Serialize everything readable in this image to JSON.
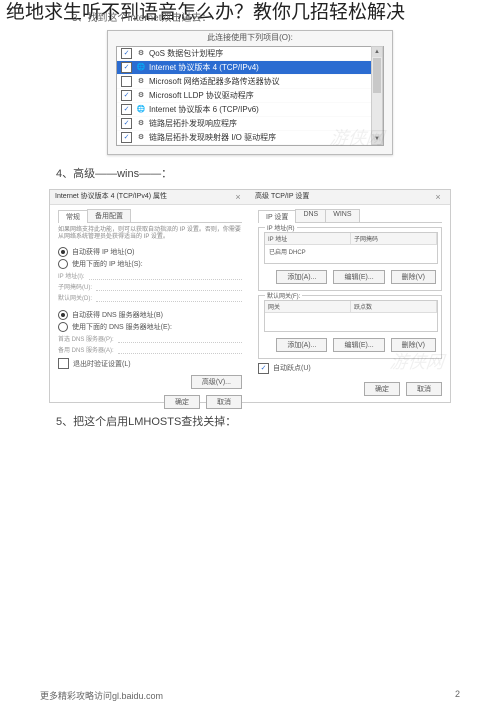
{
  "doc": {
    "title": "绝地求生听不到语音怎么办？教你几招轻松解决",
    "step3": "3、找到这个Internet双击进去：",
    "step4": "4、高级——wins——：",
    "step5": "5、把这个启用LMHOSTS查找关掉：",
    "footer_left": "更多精彩攻略访问gl.baidu.com",
    "footer_right": "2"
  },
  "shot1": {
    "caption": "此连接使用下列项目(O):",
    "watermark": "游侠网",
    "items": [
      {
        "checked": true,
        "icon": "⚙",
        "label": "QoS 数据包计划程序"
      },
      {
        "checked": true,
        "icon": "🌐",
        "label": "Internet 协议版本 4 (TCP/IPv4)",
        "selected": true
      },
      {
        "checked": false,
        "icon": "⚙",
        "label": "Microsoft 网络适配器多路传送器协议"
      },
      {
        "checked": true,
        "icon": "⚙",
        "label": "Microsoft LLDP 协议驱动程序"
      },
      {
        "checked": true,
        "icon": "🌐",
        "label": "Internet 协议版本 6 (TCP/IPv6)"
      },
      {
        "checked": true,
        "icon": "⚙",
        "label": "链路层拓扑发现响应程序"
      },
      {
        "checked": true,
        "icon": "⚙",
        "label": "链路层拓扑发现映射器 I/O 驱动程序"
      }
    ]
  },
  "dlgA": {
    "title": "Internet 协议版本 4 (TCP/IPv4) 属性",
    "tabs": [
      "常规",
      "备用配置"
    ],
    "hint": "如果网络支持此功能，则可以获取自动指派的 IP 设置。否则，你需要从网络系统管理员处获得适当的 IP 设置。",
    "r1": "自动获得 IP 地址(O)",
    "r2": "使用下面的 IP 地址(S):",
    "f1": "IP 地址(I):",
    "f2": "子网掩码(U):",
    "f3": "默认网关(D):",
    "r3": "自动获得 DNS 服务器地址(B)",
    "r4": "使用下面的 DNS 服务器地址(E):",
    "f4": "首选 DNS 服务器(P):",
    "f5": "备用 DNS 服务器(A):",
    "chk": "退出时验证设置(L)",
    "adv": "高级(V)...",
    "ok": "确定",
    "cancel": "取消"
  },
  "dlgB": {
    "title": "高级 TCP/IP 设置",
    "tabs": [
      "IP 设置",
      "DNS",
      "WINS"
    ],
    "g1": "IP 地址(R)",
    "g1c1": "IP 地址",
    "g1c2": "子网掩码",
    "g1row": "已启用 DHCP",
    "g2": "默认网关(F):",
    "g2c1": "网关",
    "g2c2": "跃点数",
    "add": "添加(A)...",
    "edit": "编辑(E)...",
    "del": "删除(V)",
    "chk": "自动跃点(U)",
    "ok": "确定",
    "cancel": "取消",
    "watermark": "游侠网"
  }
}
